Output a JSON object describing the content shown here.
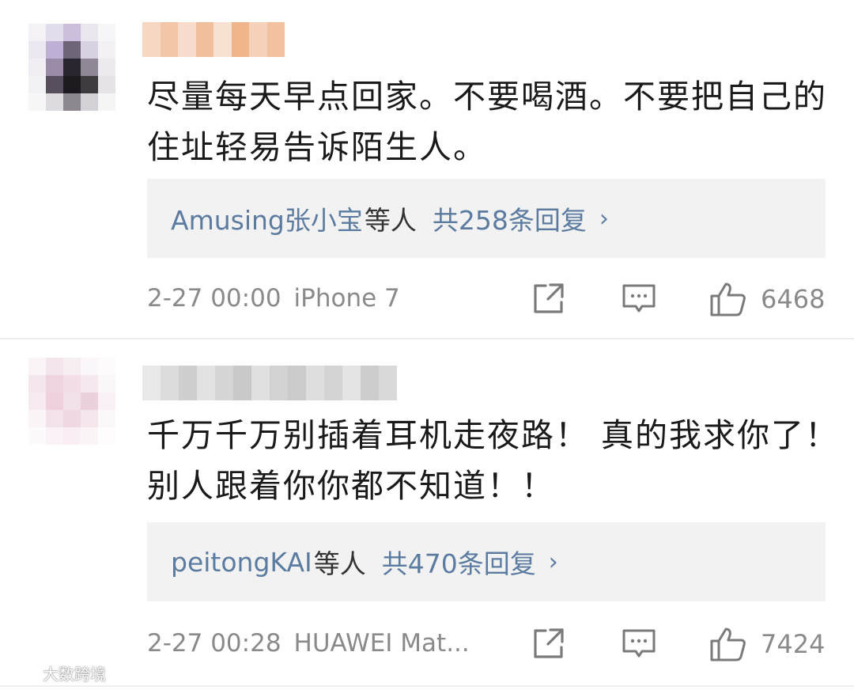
{
  "comments": [
    {
      "text": "尽量每天早点回家。不要喝酒。不要把自己的住址轻易告诉陌生人。",
      "reply_user": "Amusing张小宝",
      "reply_suffix": "等人",
      "reply_count": "共258条回复",
      "reply_chevron": "›",
      "date": "2-27 00:00",
      "device": "iPhone 7",
      "likes": "6468",
      "avatar_blurred": true,
      "username_blurred": true
    },
    {
      "text": "千万千万别插着耳机走夜路！ 真的我求你了！别人跟着你你都不知道！！",
      "reply_user": "peitongKAI",
      "reply_suffix": "等人",
      "reply_count": "共470条回复",
      "reply_chevron": "›",
      "date": "2-27 00:28",
      "device": "HUAWEI Mat...",
      "likes": "7424",
      "avatar_blurred": true,
      "username_blurred": true
    }
  ],
  "icons": {
    "share": "share-icon",
    "comment": "comment-icon",
    "like": "thumbs-up-icon"
  },
  "colors": {
    "link": "#5b7ca0",
    "meta_gray": "#8a8a8a",
    "reply_bg": "#f2f2f2",
    "icon_gray": "#7a7a7a"
  },
  "watermark": "大数跨境"
}
